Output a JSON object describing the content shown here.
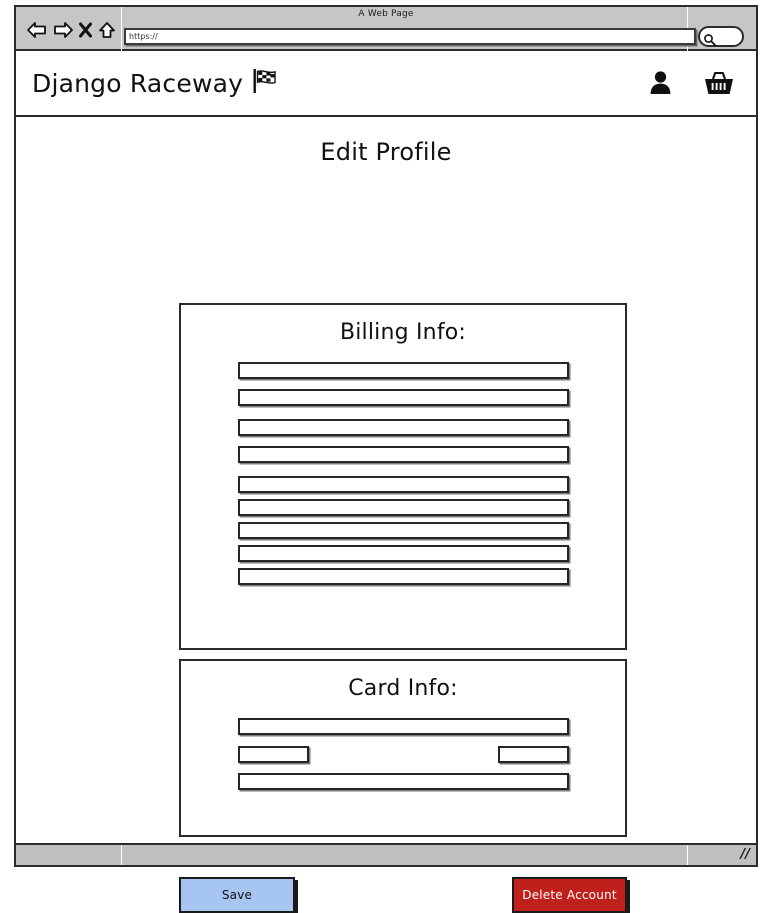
{
  "browser": {
    "window_title": "A Web Page",
    "url_value": "https://",
    "nav": {
      "back_label": "back-arrow",
      "forward_label": "forward-arrow",
      "stop_label": "stop-x",
      "home_label": "home"
    },
    "search_placeholder": ""
  },
  "header": {
    "brand": "Django Raceway",
    "flag_icon": "checkered-flag-icon",
    "account_icon": "user-icon",
    "cart_icon": "basket-icon"
  },
  "main": {
    "page_title": "Edit Profile",
    "billing": {
      "title": "Billing Info:",
      "fields": [
        {
          "value": "",
          "placeholder": ""
        },
        {
          "value": "",
          "placeholder": ""
        },
        {
          "value": "",
          "placeholder": ""
        },
        {
          "value": "",
          "placeholder": ""
        },
        {
          "value": "",
          "placeholder": ""
        },
        {
          "value": "",
          "placeholder": ""
        },
        {
          "value": "",
          "placeholder": ""
        },
        {
          "value": "",
          "placeholder": ""
        },
        {
          "value": "",
          "placeholder": ""
        }
      ]
    },
    "card": {
      "title": "Card Info:",
      "number_field": {
        "value": "",
        "placeholder": ""
      },
      "small_left_field": {
        "value": "",
        "placeholder": ""
      },
      "small_right_field": {
        "value": "",
        "placeholder": ""
      },
      "bottom_field": {
        "value": "",
        "placeholder": ""
      }
    },
    "actions": {
      "save_label": "Save",
      "delete_label": "Delete Account"
    }
  },
  "colors": {
    "save_bg": "#a6c5f0",
    "delete_bg": "#c0201b",
    "chrome_bg": "#c6c6c6",
    "outline": "#2b2b2b"
  },
  "statusbar": {
    "resize_grip": "//"
  }
}
